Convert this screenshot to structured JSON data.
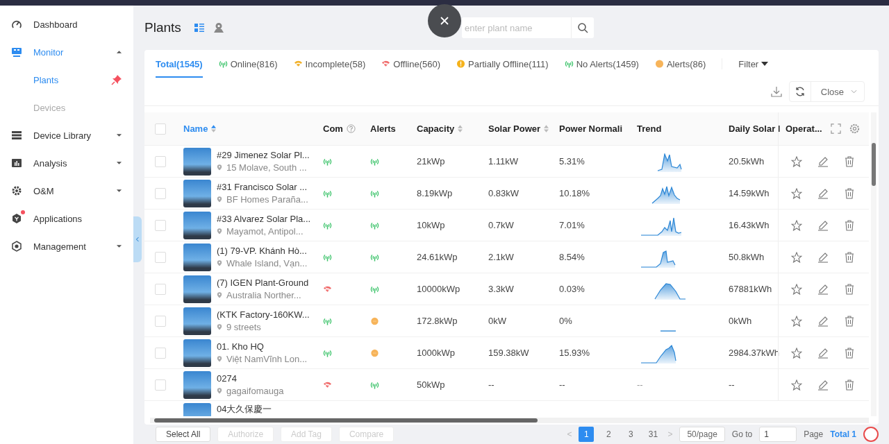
{
  "sidebar": {
    "items": [
      {
        "kind": "dashboard",
        "label": "Dashboard",
        "selected": false
      },
      {
        "kind": "monitor",
        "label": "Monitor",
        "selected": true,
        "expanded": true,
        "children": [
          {
            "label": "Plants",
            "selected": true,
            "disabled": false,
            "pinned": true
          },
          {
            "label": "Devices",
            "selected": false,
            "disabled": true,
            "pinned": false
          }
        ]
      },
      {
        "kind": "library",
        "label": "Device Library",
        "selected": false,
        "expanded": false
      },
      {
        "kind": "analysis",
        "label": "Analysis",
        "selected": false,
        "expanded": false
      },
      {
        "kind": "om",
        "label": "O&M",
        "selected": false,
        "expanded": false
      },
      {
        "kind": "apps",
        "label": "Applications",
        "selected": false,
        "badge": true
      },
      {
        "kind": "management",
        "label": "Management",
        "selected": false,
        "expanded": false
      }
    ]
  },
  "header": {
    "title": "Plants",
    "view_modes": [
      {
        "kind": "list",
        "selected": true
      },
      {
        "kind": "map",
        "selected": false
      }
    ],
    "search": {
      "placeholder": "enter plant name"
    }
  },
  "tabs": [
    {
      "label": "Total(1545)",
      "kind": "total",
      "selected": true
    },
    {
      "label": "Online(816)",
      "kind": "online",
      "selected": false
    },
    {
      "label": "Incomplete(58)",
      "kind": "incomplete",
      "selected": false
    },
    {
      "label": "Offline(560)",
      "kind": "offline",
      "selected": false
    },
    {
      "label": "Partially Offline(111)",
      "kind": "partial",
      "selected": false
    },
    {
      "label": "No Alerts(1459)",
      "kind": "online",
      "selected": false
    },
    {
      "label": "Alerts(86)",
      "kind": "alert",
      "selected": false
    }
  ],
  "filter": "Filter",
  "close_select": "Close",
  "table": {
    "select_all_checked": false,
    "columns": [
      {
        "label": "Name",
        "sortable": true,
        "sorted": true
      },
      {
        "label": "Com",
        "help": true
      },
      {
        "label": "Alerts"
      },
      {
        "label": "Capacity",
        "sortable": true,
        "sorted": false
      },
      {
        "label": "Solar Power",
        "sortable": true,
        "sorted": false
      },
      {
        "label": "Power Normali"
      },
      {
        "label": "Trend"
      },
      {
        "label": "Daily Solar I"
      },
      {
        "label": "Operat..."
      }
    ],
    "rows": [
      {
        "checked": false,
        "name": "#29 Jimenez Solar Pl...",
        "address": "15 Molave, South ...",
        "com_online": true,
        "alert": false,
        "capacity": "21kWp",
        "solar_power": "1.11kW",
        "power_norm": "5.31%",
        "daily": "20.5kWh"
      },
      {
        "checked": false,
        "name": "#31 Francisco Solar ...",
        "address": "BF Homes Parañа...",
        "com_online": true,
        "alert": false,
        "capacity": "8.19kWp",
        "solar_power": "0.83kW",
        "power_norm": "10.18%",
        "daily": "14.59kWh"
      },
      {
        "checked": false,
        "name": "#33 Alvarez Solar Pla...",
        "address": "Mayamot, Antipol...",
        "com_online": true,
        "alert": false,
        "capacity": "10kWp",
        "solar_power": "0.7kW",
        "power_norm": "7.01%",
        "daily": "16.43kWh"
      },
      {
        "checked": false,
        "name": "(1) 79-VP. Khánh Hò...",
        "address": "Whale Island, Vạn...",
        "com_online": true,
        "alert": false,
        "capacity": "24.61kWp",
        "solar_power": "2.1kW",
        "power_norm": "8.54%",
        "daily": "50.8kWh"
      },
      {
        "checked": false,
        "name": "(7) IGEN Plant-Ground",
        "address": "Australia Norther...",
        "com_online": false,
        "alert": false,
        "capacity": "10000kWp",
        "solar_power": "3.3kW",
        "power_norm": "0.03%",
        "daily": "67881kWh"
      },
      {
        "checked": false,
        "name": "(KTK Factory-160KW...",
        "address": "9 streets",
        "com_online": true,
        "alert": true,
        "capacity": "172.8kWp",
        "solar_power": "0kW",
        "power_norm": "0%",
        "daily": "0kWh"
      },
      {
        "checked": false,
        "name": "01. Kho HQ",
        "address": "Việt NamVĩnh Lon...",
        "com_online": true,
        "alert": true,
        "capacity": "1000kWp",
        "solar_power": "159.38kW",
        "power_norm": "15.93%",
        "daily": "2984.37kWh"
      },
      {
        "checked": false,
        "name": "0274",
        "address": "gagaifomauga",
        "com_online": false,
        "alert": false,
        "capacity": "50kWp",
        "solar_power": "--",
        "power_norm": "--",
        "trend_text": "--",
        "daily": "--"
      },
      {
        "name": "04大久保慶一"
      }
    ]
  },
  "footer_buttons": [
    {
      "label": "Select All",
      "disabled": false
    },
    {
      "label": "Authorize",
      "disabled": true
    },
    {
      "label": "Add Tag",
      "disabled": true
    },
    {
      "label": "Compare",
      "disabled": true
    }
  ],
  "pagination": {
    "prev": "<",
    "pages": [
      {
        "label": "1",
        "selected": true
      },
      {
        "label": "2",
        "selected": false
      },
      {
        "label": "3",
        "selected": false
      },
      {
        "label": "31",
        "selected": false
      }
    ],
    "next": ">",
    "page_size": "50/page",
    "goto_label": "Go to",
    "goto_value": "1",
    "page_label": "Page",
    "total": "Total 1"
  }
}
